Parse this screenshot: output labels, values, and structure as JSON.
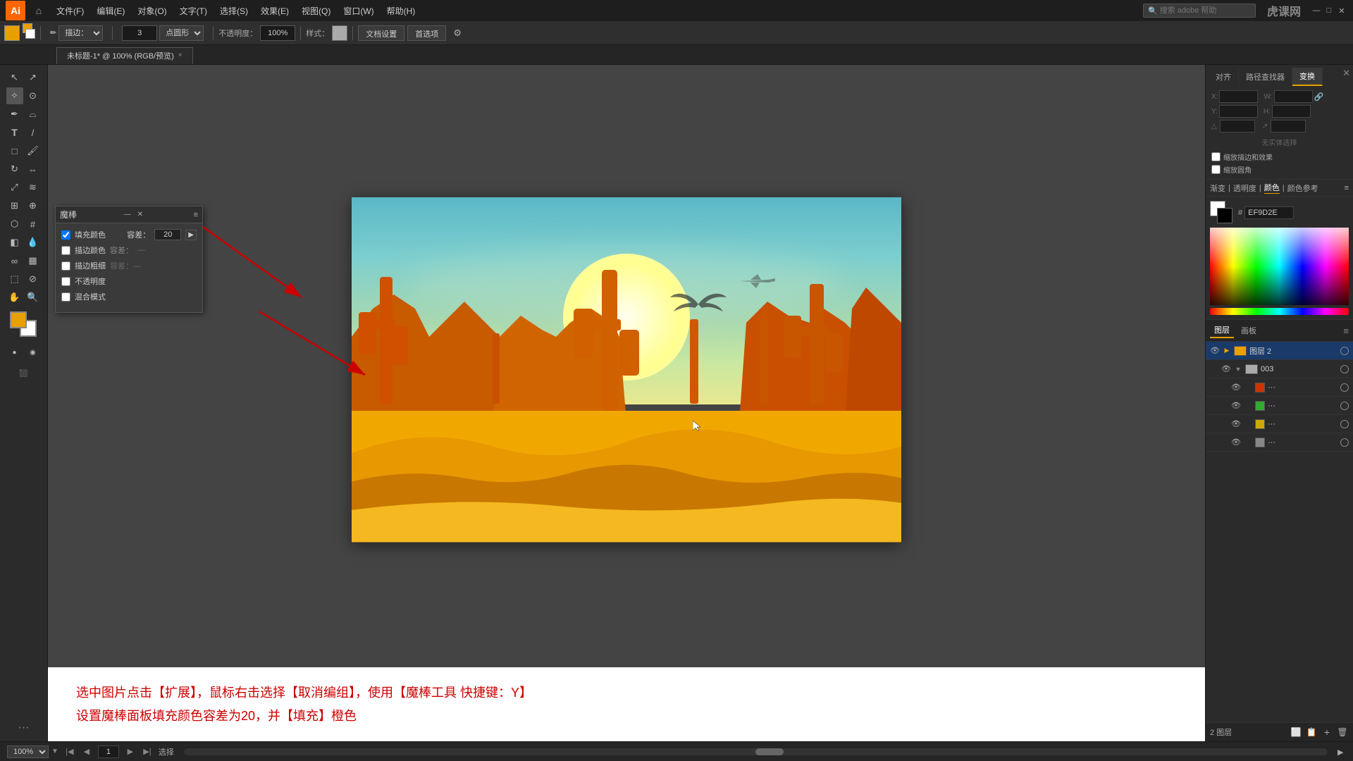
{
  "app": {
    "logo": "Ai",
    "title": "Adobe Illustrator"
  },
  "menus": {
    "items": [
      "文件(F)",
      "编辑(E)",
      "对象(O)",
      "文字(T)",
      "选择(S)",
      "效果(E)",
      "视图(Q)",
      "窗口(W)",
      "帮助(H)"
    ]
  },
  "toolbar": {
    "fill_label": "填充",
    "stroke_label": "描边",
    "brush_label": "描边：",
    "brush_size": "3",
    "brush_type": "点圆形",
    "opacity_label": "不透明度：",
    "opacity_value": "100%",
    "style_label": "样式：",
    "config_btn": "文档设置",
    "preference_btn": "首选项"
  },
  "tab": {
    "title": "未标题-1* @ 100% (RGB/预览)",
    "close": "×"
  },
  "magic_wand_panel": {
    "title": "魔棒",
    "fill_color": "填充颜色",
    "fill_tolerance_label": "容差：",
    "fill_tolerance_value": "20",
    "stroke_color": "描边颜色",
    "stroke_tolerance_label": "容差：",
    "stroke_weight": "描边粗细",
    "stroke_weight_label": "容差：",
    "opacity": "不透明度",
    "blend_mode": "混合模式"
  },
  "right_panel": {
    "tabs": [
      "对齐",
      "路径查找器",
      "变换"
    ],
    "active_tab": "变换",
    "color_tabs": [
      "渐变",
      "透明度",
      "颜色",
      "颜色参考"
    ],
    "hex_label": "#",
    "hex_value": "EF9D2E"
  },
  "layers_panel": {
    "tabs": [
      "图层",
      "画板"
    ],
    "active_tab": "图层",
    "layer_group": "图层 2",
    "layer_item": "003",
    "sub_layers": [
      "...",
      "...",
      "...",
      "..."
    ],
    "sub_colors": [
      "#cc3300",
      "#33aa33",
      "#ccaa00",
      "#888888"
    ],
    "footer_label": "2 图层"
  },
  "canvas": {
    "zoom": "100%"
  },
  "annotation": {
    "line1": "选中图片点击【扩展】，鼠标右击选择【取消编组】，使用【魔棒工具 快捷键：Y】",
    "line2": "设置魔棒面板填充颜色容差为20，并【填充】橙色"
  },
  "status_bar": {
    "zoom": "100%",
    "page_label": "选择",
    "page_num": "1"
  },
  "watermark": "虎课网"
}
